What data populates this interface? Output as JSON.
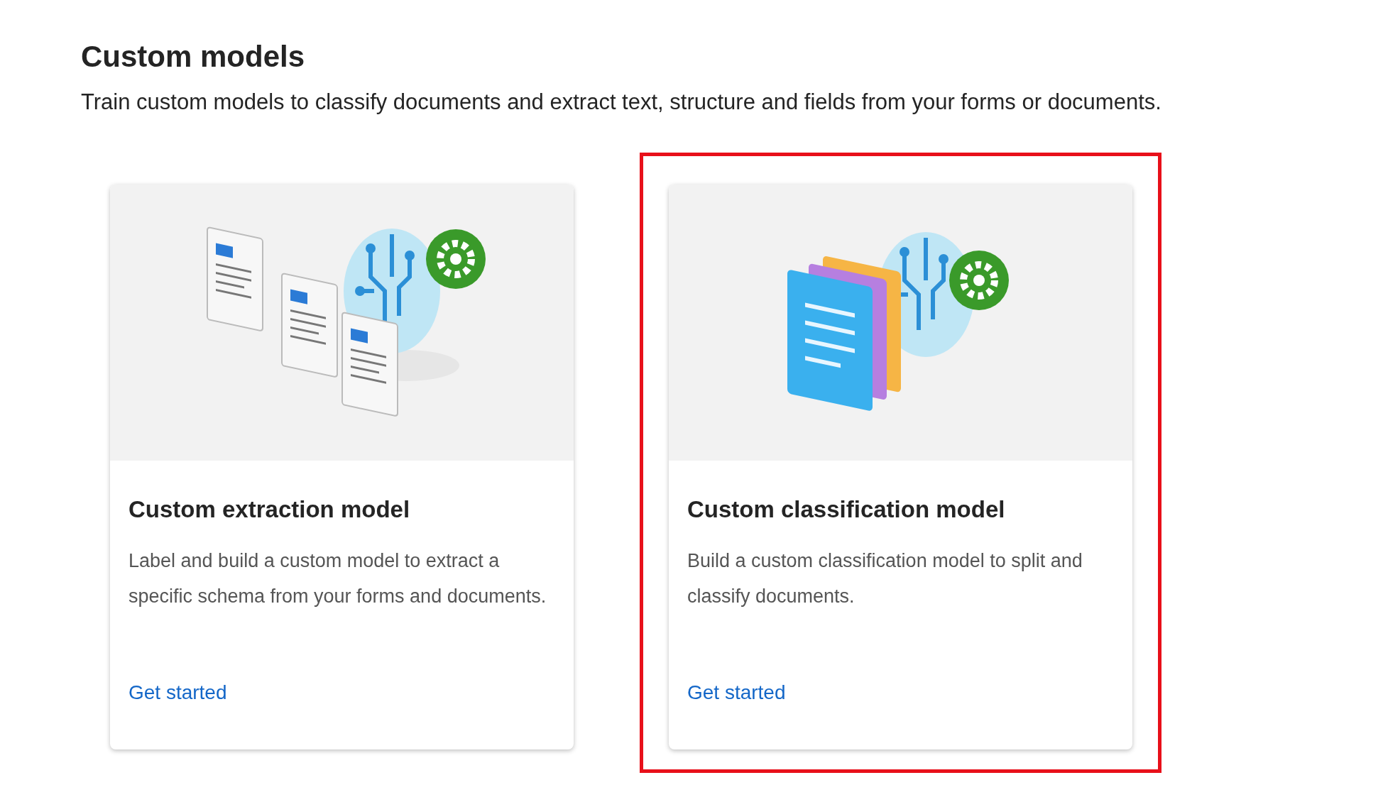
{
  "section": {
    "title": "Custom models",
    "description": "Train custom models to classify documents and extract text, structure and fields from your forms or documents."
  },
  "cards": [
    {
      "kind": "extraction",
      "title": "Custom extraction model",
      "description": "Label and build a custom model to extract a specific schema from your forms and documents.",
      "link": "Get started",
      "highlighted": false
    },
    {
      "kind": "classification",
      "title": "Custom classification model",
      "description": "Build a custom classification model to split and classify documents.",
      "link": "Get started",
      "highlighted": true
    }
  ]
}
